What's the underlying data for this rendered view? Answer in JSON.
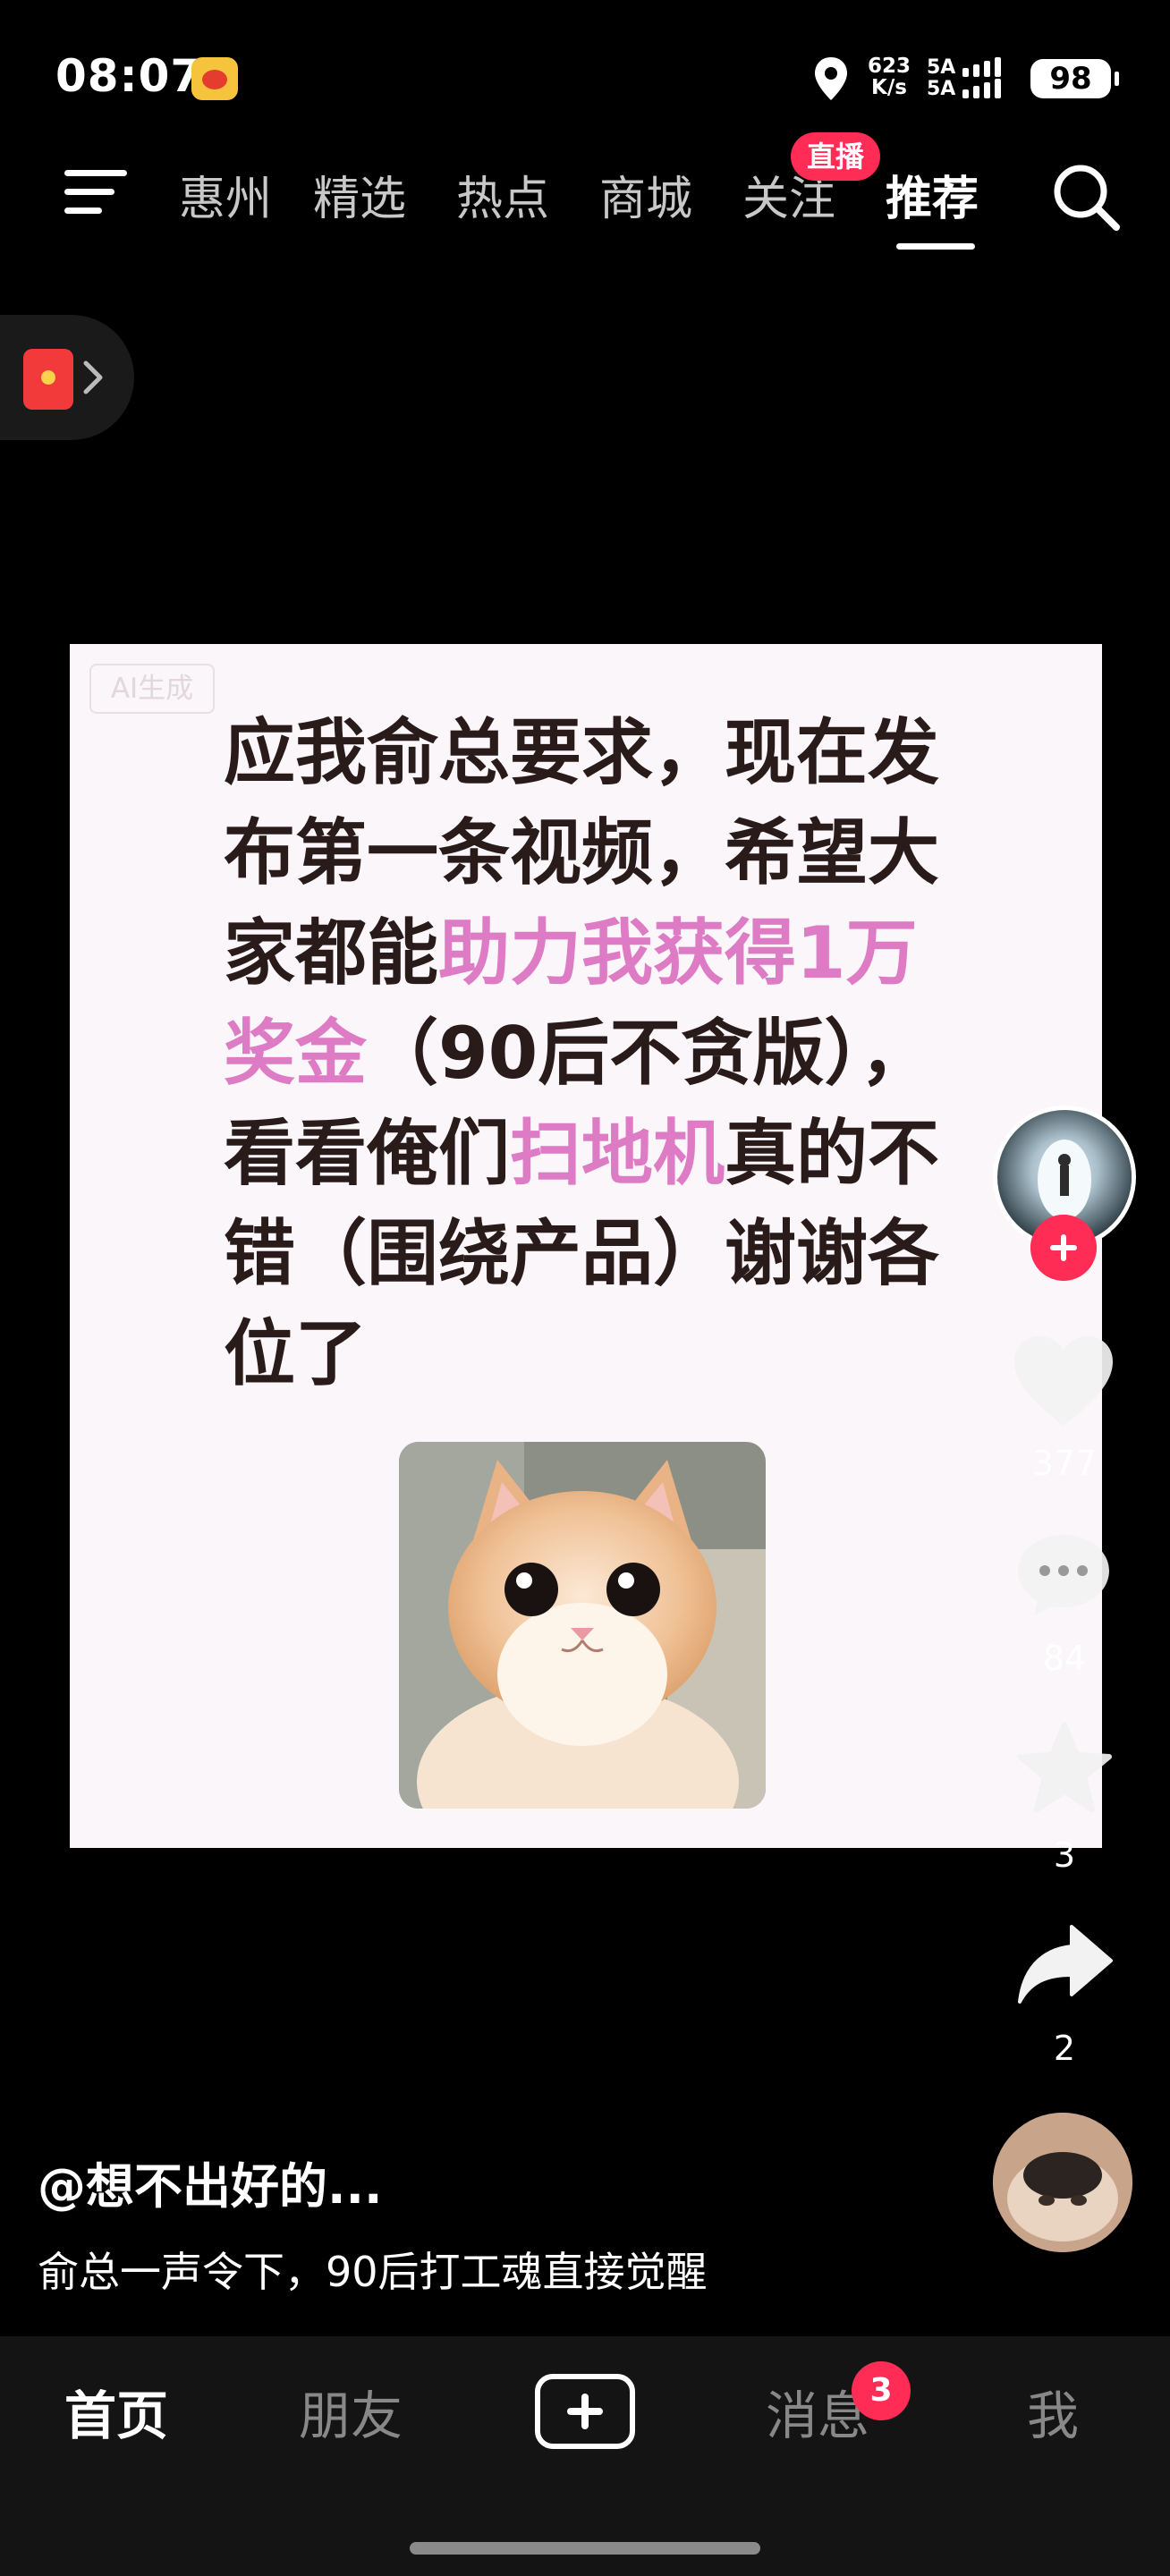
{
  "status_bar": {
    "time": "08:07",
    "net_speed_value": "623",
    "net_speed_unit": "K/s",
    "signal_label_1": "5A",
    "signal_label_2": "5A",
    "battery": "98"
  },
  "top_nav": {
    "tabs": [
      {
        "label": "惠州"
      },
      {
        "label": "精选"
      },
      {
        "label": "热点"
      },
      {
        "label": "商城"
      },
      {
        "label": "关注"
      },
      {
        "label": "推荐"
      }
    ],
    "active_tab": "推荐",
    "live_badge": "直播"
  },
  "video": {
    "ai_tag": "AI生成",
    "text_parts": [
      "应我俞总要求，现在发布第一条视频，希望大家都能",
      "助力我获得1万奖金",
      "（90后不贪版），看看俺们",
      "扫地机",
      "真的不错（围绕产品）谢谢各位了"
    ],
    "highlight_color": "#de7bc5"
  },
  "actions": {
    "like_count": "377",
    "comment_count": "84",
    "favorite_count": "3",
    "share_count": "2"
  },
  "caption": {
    "author": "@想不出好的...",
    "text": "俞总一声令下，90后打工魂直接觉醒"
  },
  "tab_bar": {
    "items": [
      {
        "label": "首页"
      },
      {
        "label": "朋友"
      },
      {
        "label": "消息"
      },
      {
        "label": "我"
      }
    ],
    "message_badge": "3"
  },
  "colors": {
    "accent": "#ff2c55",
    "background": "#000000"
  }
}
